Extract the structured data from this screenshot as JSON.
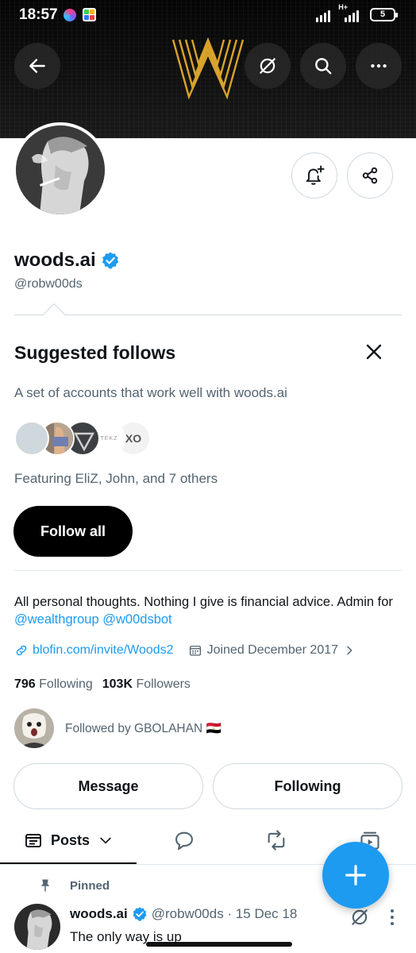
{
  "status_bar": {
    "time": "18:57",
    "network": "H+",
    "battery": "5"
  },
  "profile": {
    "display_name": "woods.ai",
    "handle": "@robw00ds",
    "verified": true,
    "bio_text": "All personal thoughts. Nothing I give is financial advice. Admin for ",
    "bio_mention_1": "@wealthgroup",
    "bio_mention_2": "@w00dsbot",
    "website": "blofin.com/invite/Woods2",
    "joined": "Joined December 2017",
    "following_count": "796",
    "following_label": "Following",
    "followers_count": "103K",
    "followers_label": "Followers",
    "followed_by": "Followed by GBOLAHAN 🇪🇬"
  },
  "suggested": {
    "title": "Suggested follows",
    "subtitle": "A set of accounts that work well with woods.ai",
    "featuring": "Featuring EliZ, John, and 7 others",
    "follow_all_label": "Follow all",
    "faces": [
      "blank-avatar",
      "person-avatar",
      "chevron-logo-avatar",
      "itekz-logo-avatar",
      "xo-logo-avatar"
    ],
    "face_texts": {
      "itekz": "ITEKZ",
      "xo": "XO"
    }
  },
  "actions": {
    "message_label": "Message",
    "following_label": "Following"
  },
  "tabs": {
    "posts_label": "Posts"
  },
  "pinned_post": {
    "pinned_label": "Pinned",
    "author": "woods.ai",
    "handle_date": "@robw00ds · 15 Dec 18",
    "text": "The only way is up"
  },
  "colors": {
    "accent": "#1d9bf0",
    "banner_gold": "#d9a32b",
    "text_primary": "#0f1419",
    "text_secondary": "#536471"
  }
}
